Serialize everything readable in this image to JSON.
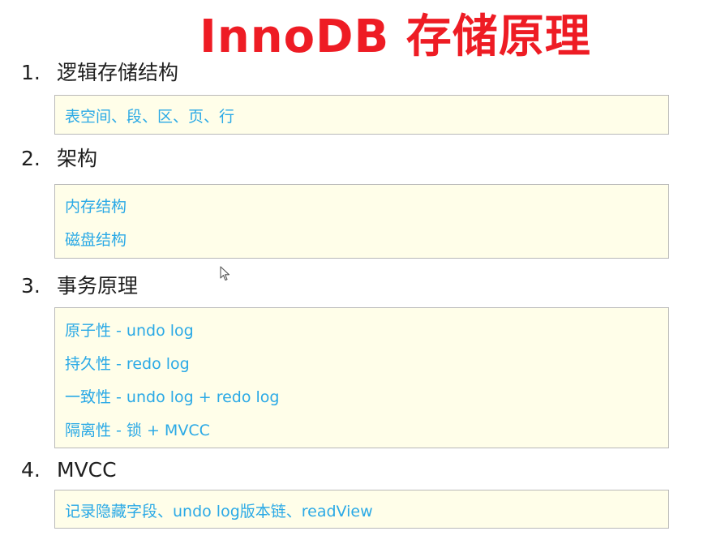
{
  "title": "InnoDB 存储原理",
  "sections": [
    {
      "number": "1.",
      "heading": "逻辑存储结构",
      "items": [
        "表空间、段、区、页、行"
      ]
    },
    {
      "number": "2.",
      "heading": "架构",
      "items": [
        "内存结构",
        "磁盘结构"
      ]
    },
    {
      "number": "3.",
      "heading": "事务原理",
      "items": [
        "原子性 - undo log",
        "持久性 - redo log",
        "一致性 - undo log + redo log",
        "隔离性 - 锁 + MVCC"
      ]
    },
    {
      "number": "4.",
      "heading": "MVCC",
      "items": [
        "记录隐藏字段、undo log版本链、readView"
      ]
    }
  ],
  "colors": {
    "title": "#ee1c24",
    "heading": "#1e1e1e",
    "item_text": "#2aa9e6",
    "box_background": "#fffee9",
    "box_border": "#b9b9b9"
  },
  "cursor_icon": "mouse-pointer-icon"
}
